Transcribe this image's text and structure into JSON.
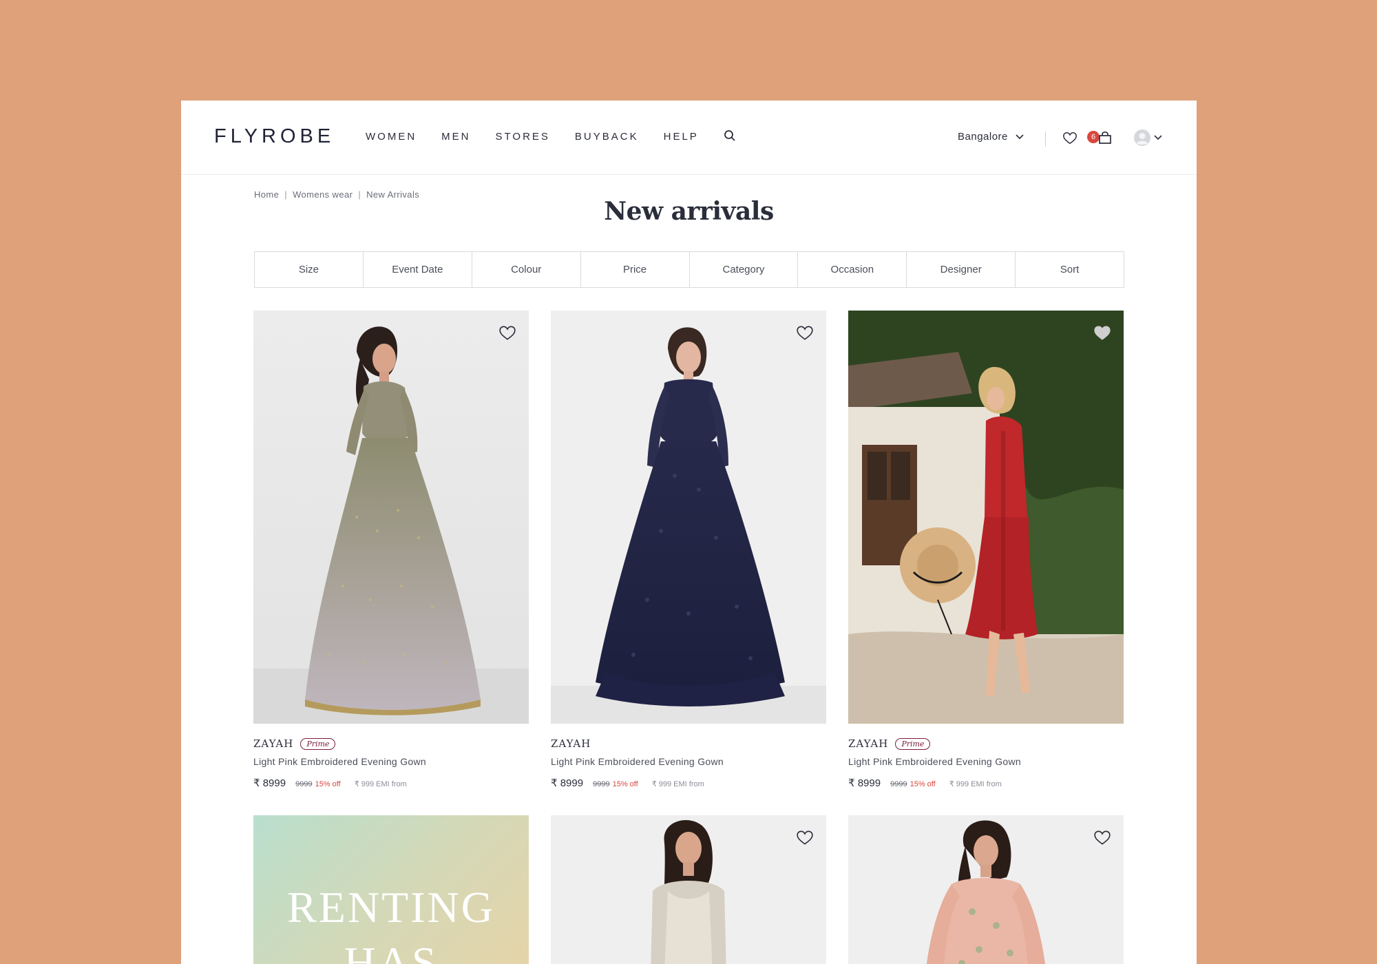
{
  "header": {
    "logo": "FLYROBE",
    "nav": [
      "WOMEN",
      "MEN",
      "STORES",
      "BUYBACK",
      "HELP"
    ],
    "city": "Bangalore",
    "cart_count": "6"
  },
  "breadcrumb": [
    "Home",
    "Womens wear",
    "New Arrivals"
  ],
  "title": "New arrivals",
  "filters": [
    "Size",
    "Event Date",
    "Colour",
    "Price",
    "Category",
    "Occasion",
    "Designer",
    "Sort"
  ],
  "products": [
    {
      "brand": "ZAYAH",
      "prime": "Prime",
      "name": "Light Pink Embroidered Evening Gown",
      "price": "₹ 8999",
      "mrp": "9999",
      "off": "15% off",
      "emi": "₹ 999 EMI from"
    },
    {
      "brand": "ZAYAH",
      "name": "Light Pink Embroidered Evening Gown",
      "price": "₹ 8999",
      "mrp": "9999",
      "off": "15% off",
      "emi": "₹ 999 EMI from"
    },
    {
      "brand": "ZAYAH",
      "prime": "Prime",
      "name": "Light Pink Embroidered Evening Gown",
      "price": "₹ 8999",
      "mrp": "9999",
      "off": "15% off",
      "emi": "₹ 999 EMI from"
    }
  ],
  "promo": {
    "line1": "RENTING",
    "line2": "HAS"
  },
  "colors": {
    "background": "#DFA17A",
    "accent": "#d9473e",
    "prime": "#7a1c3a"
  }
}
